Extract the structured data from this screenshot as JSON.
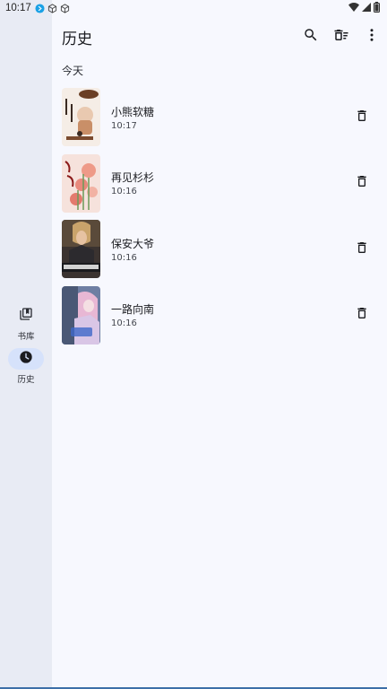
{
  "status_bar": {
    "time": "10:17",
    "icons": [
      "notification-dot-icon",
      "cube-icon",
      "cube-icon",
      "wifi-icon",
      "signal-icon",
      "battery-icon"
    ]
  },
  "nav": {
    "items": [
      {
        "label": "书库",
        "icon": "library-icon",
        "active": false
      },
      {
        "label": "历史",
        "icon": "history-clock-icon",
        "active": true
      }
    ]
  },
  "appbar": {
    "title": "历史",
    "actions": [
      "search-icon",
      "clear-all-icon",
      "more-vert-icon"
    ]
  },
  "section": {
    "label": "今天"
  },
  "history": [
    {
      "title": "小熊软糖",
      "time": "10:17",
      "cover_colors": [
        "#f5ede6",
        "#7a4a2e"
      ]
    },
    {
      "title": "再见杉杉",
      "time": "10:16",
      "cover_colors": [
        "#f6e2dc",
        "#e8897c"
      ]
    },
    {
      "title": "保安大爷",
      "time": "10:16",
      "cover_colors": [
        "#3b3330",
        "#c9a36b"
      ]
    },
    {
      "title": "一路向南",
      "time": "10:16",
      "cover_colors": [
        "#6e7ea3",
        "#e8b7d4"
      ]
    }
  ],
  "colors": {
    "rail_bg": "#e8ebf4",
    "active_pill": "#d6e2fb",
    "page_bg": "#f7f8fe"
  }
}
